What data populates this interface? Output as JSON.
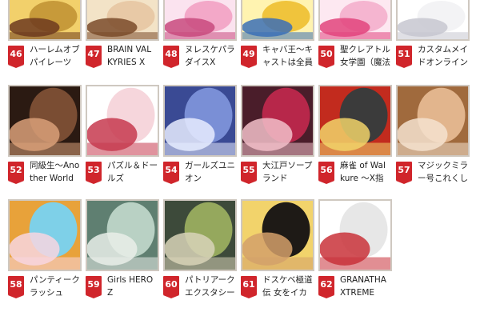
{
  "rows": [
    {
      "items": [
        {
          "rank": "46",
          "title_lines": [
            "ハーレムオブ",
            "パイレーツ"
          ],
          "thumb": "thumb-game-46",
          "colors": [
            "#c79a3a",
            "#6d3a1e",
            "#f2d06b"
          ]
        },
        {
          "rank": "47",
          "title_lines": [
            "BRAIN VAL",
            "KYRIES X"
          ],
          "thumb": "thumb-game-47",
          "colors": [
            "#e8c9a6",
            "#7a4b2a",
            "#f3e3c7"
          ]
        },
        {
          "rank": "48",
          "title_lines": [
            "ヌレスケパラ",
            "ダイスX"
          ],
          "thumb": "thumb-game-48",
          "colors": [
            "#f3a8c8",
            "#c84a7e",
            "#fbe3ef"
          ]
        },
        {
          "rank": "49",
          "title_lines": [
            "キャバ王～キ",
            "ャストは全員"
          ],
          "thumb": "thumb-game-49",
          "colors": [
            "#f0c43c",
            "#3b6fb6",
            "#fff3b0"
          ]
        },
        {
          "rank": "50",
          "title_lines": [
            "聖クレアトル",
            "女学園（魔法"
          ],
          "thumb": "thumb-game-50",
          "colors": [
            "#f5b5d0",
            "#e2447d",
            "#fde8f1"
          ]
        },
        {
          "rank": "51",
          "title_lines": [
            "カスタムメイ",
            "ドオンライン"
          ],
          "thumb": "thumb-game-51",
          "colors": [
            "#f3f3f5",
            "#c7c7d0",
            "#ffffff"
          ]
        }
      ]
    },
    {
      "items": [
        {
          "rank": "52",
          "title_lines": [
            "同級生～Ano",
            "ther World"
          ],
          "thumb": "thumb-game-52",
          "colors": [
            "#7a4d33",
            "#d9a079",
            "#2b1a12"
          ]
        },
        {
          "rank": "53",
          "title_lines": [
            "パズル＆ドー",
            "ルズ"
          ],
          "thumb": "thumb-game-53",
          "colors": [
            "#f6d6dc",
            "#c73a4f",
            "#ffffff"
          ]
        },
        {
          "rank": "54",
          "title_lines": [
            "ガールズユニ",
            "オン"
          ],
          "thumb": "thumb-game-54",
          "colors": [
            "#7a8fd6",
            "#e7ecff",
            "#3a4a94"
          ]
        },
        {
          "rank": "55",
          "title_lines": [
            "大江戸ソープ",
            "ランド"
          ],
          "thumb": "thumb-game-55",
          "colors": [
            "#b7274a",
            "#f2c0c9",
            "#4a1d2a"
          ]
        },
        {
          "rank": "56",
          "title_lines": [
            "麻雀 of Wal",
            "kure ～X指"
          ],
          "thumb": "thumb-game-56",
          "colors": [
            "#3b3b3b",
            "#f1d36a",
            "#c22b1e"
          ]
        },
        {
          "rank": "57",
          "title_lines": [
            "マジックミラ",
            "ー号これくし"
          ],
          "thumb": "thumb-game-57",
          "colors": [
            "#e2b58d",
            "#f4e2cf",
            "#a06a3d"
          ]
        }
      ]
    },
    {
      "items": [
        {
          "rank": "58",
          "title_lines": [
            "パンティーク",
            "ラッシュ"
          ],
          "thumb": "thumb-game-58",
          "colors": [
            "#7ed0e8",
            "#f7d6e0",
            "#e8a23a"
          ]
        },
        {
          "rank": "59",
          "title_lines": [
            "Girls HERO",
            "Z"
          ],
          "thumb": "thumb-game-59",
          "colors": [
            "#b9d1c4",
            "#e9efe9",
            "#5f7f71"
          ]
        },
        {
          "rank": "60",
          "title_lines": [
            "パトリアーク",
            "エクスタシー"
          ],
          "thumb": "thumb-game-60",
          "colors": [
            "#95a85d",
            "#d8d3b8",
            "#3d4a3a"
          ]
        },
        {
          "rank": "61",
          "title_lines": [
            "ドスケベ極道",
            "伝 女をイカ"
          ],
          "thumb": "thumb-game-61",
          "colors": [
            "#1e1a16",
            "#d4a06a",
            "#f2d36b"
          ]
        },
        {
          "rank": "62",
          "title_lines": [
            "GRANATHA",
            "XTREME"
          ],
          "thumb": "thumb-game-62",
          "colors": [
            "#e7e7e7",
            "#c9323a",
            "#ffffff"
          ]
        }
      ]
    }
  ]
}
